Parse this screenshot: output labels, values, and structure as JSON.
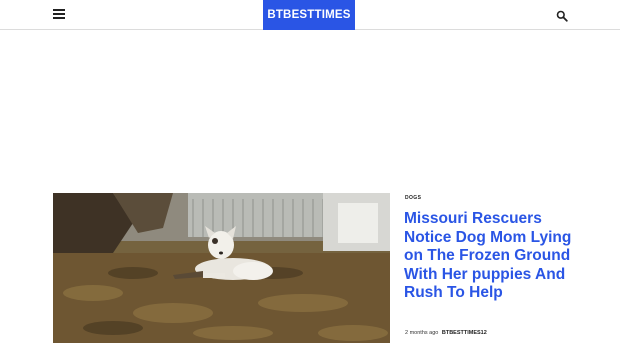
{
  "header": {
    "logo_text": "BTBESTTIMES",
    "menu_icon": "hamburger-menu-icon",
    "search_icon": "search-icon"
  },
  "article": {
    "category": "DOGS",
    "title": "Missouri Rescuers Notice Dog Mom Lying on The Frozen Ground With Her puppies And Rush To Help",
    "time_ago": "2 months ago",
    "author": "BTBESTTIMES12"
  },
  "colors": {
    "brand": "#2a55e5",
    "header_border": "#dcdcdc"
  }
}
